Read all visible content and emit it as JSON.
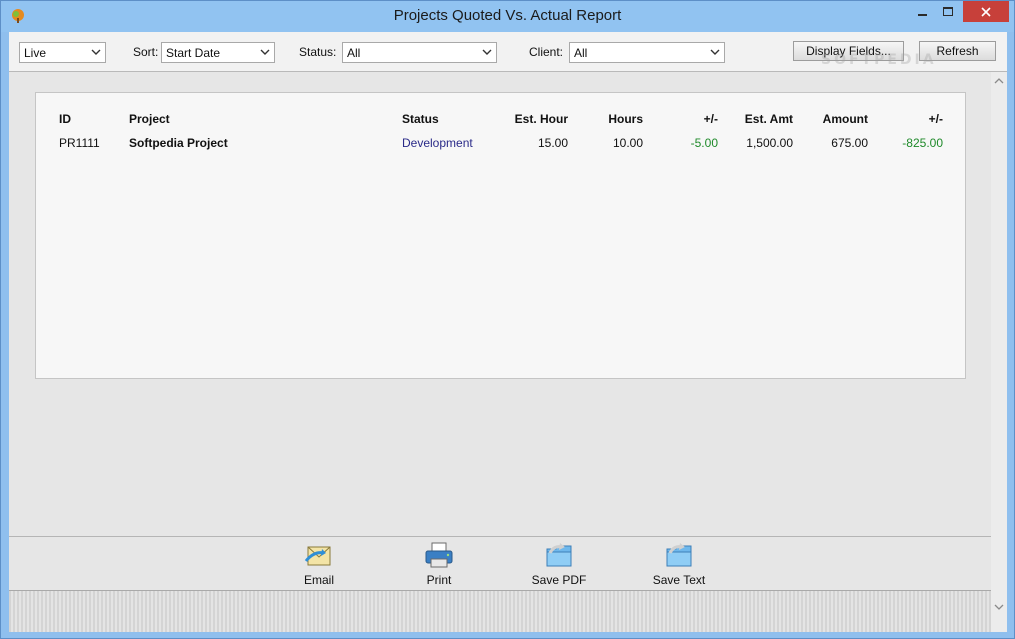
{
  "window": {
    "title": "Projects Quoted Vs. Actual Report"
  },
  "toolbar": {
    "view_select": "Live",
    "sort_label": "Sort:",
    "sort_value": "Start Date",
    "status_label": "Status:",
    "status_value": "All",
    "client_label": "Client:",
    "client_value": "All",
    "display_fields_label": "Display Fields...",
    "refresh_label": "Refresh",
    "watermark": "SOFTPEDIA"
  },
  "report": {
    "columns": {
      "id": "ID",
      "project": "Project",
      "status": "Status",
      "est_hour": "Est. Hour",
      "hours": "Hours",
      "hours_diff": "+/-",
      "est_amt": "Est. Amt",
      "amount": "Amount",
      "amount_diff": "+/-"
    },
    "rows": [
      {
        "id": "PR1111",
        "project": "Softpedia Project",
        "status": "Development",
        "est_hour": "15.00",
        "hours": "10.00",
        "hours_diff": "-5.00",
        "est_amt": "1,500.00",
        "amount": "675.00",
        "amount_diff": "-825.00"
      }
    ]
  },
  "actions": {
    "email": "Email",
    "print": "Print",
    "save_pdf": "Save PDF",
    "save_text": "Save Text"
  },
  "colors": {
    "accent": "#91c3f1",
    "negative": "#1f8a2a",
    "link": "#2a2a88",
    "close": "#c7403a"
  }
}
